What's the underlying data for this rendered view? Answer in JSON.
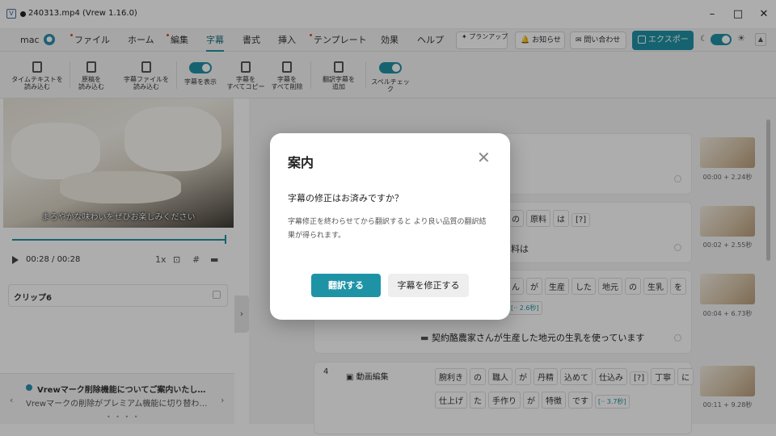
{
  "window": {
    "title": "240313.mp4 (Vrew 1.16.0)",
    "logo_letter": "V"
  },
  "window_controls": {
    "minimize": "–",
    "maximize": "□",
    "close": "✕"
  },
  "menubar": {
    "user": "mac",
    "items": [
      "ファイル",
      "ホーム",
      "編集",
      "字幕",
      "書式",
      "挿入",
      "テンプレート",
      "効果",
      "ヘルプ"
    ],
    "plan_up": "プランアップ",
    "notifications": "お知らせ",
    "contact": "問い合わせ",
    "export": "エクスポート"
  },
  "toolbar": {
    "items": [
      "タイムテキストを\n読み込む",
      "原稿を\n読み込む",
      "字幕ファイルを\n読み込む",
      "字幕を表示",
      "字幕を\nすべてコピー",
      "字幕を\nすべて削除",
      "翻訳字幕を\n追加",
      "スペルチェッ\nク"
    ]
  },
  "player": {
    "caption": "まろやかな味わいをぜひお楽しみください",
    "current_time": "00:28",
    "total_time": "/ 00:28",
    "speed": "1x",
    "progress": 1.0
  },
  "clip": {
    "label": "クリップ6"
  },
  "notice": {
    "title": "Vrewマーク削除機能についてご案内いたし…",
    "body": "Vrewマークの削除がプレミアム機能に切り替わ…",
    "pager": "• • • •"
  },
  "transcript": {
    "rows": [
      {
        "num": "",
        "words": [],
        "gap": "",
        "subtitle": "",
        "time": "00:00 + 2.24秒"
      },
      {
        "num": "",
        "words": [
          "の",
          "原料",
          "は",
          "[?]"
        ],
        "gap": "",
        "subtitle": "料は",
        "time": "00:02 + 2.55秒"
      },
      {
        "num": "",
        "words": [
          "ん",
          "が",
          "生産",
          "した",
          "地元",
          "の",
          "生乳",
          "を"
        ],
        "gap": "[·· 2.6秒]",
        "subtitle": "契約酪農家さんが生産した地元の生乳を使っています",
        "time": "00:04 + 6.73秒"
      },
      {
        "num": "4",
        "label": "動画編集",
        "words": [
          "腕利き",
          "の",
          "職人",
          "が",
          "丹精",
          "込めて",
          "仕込み",
          "[?]",
          "丁寧",
          "に"
        ],
        "words2": [
          "仕上げ",
          "た",
          "手作り",
          "が",
          "特徴",
          "です"
        ],
        "gap": "[·· 3.7秒]",
        "subtitle": "",
        "time": "00:11 + 9.28秒"
      }
    ]
  },
  "modal": {
    "title": "案内",
    "question": "字幕の修正はお済みですか？",
    "description": "字幕修正を終わらせてから翻訳すると より良い品質の翻訳結果が得られます。",
    "translate_button": "翻訳する",
    "fix_button": "字幕を修正する"
  },
  "colors": {
    "accent": "#1f93a6",
    "overlay": "rgba(0,0,0,0.32)"
  }
}
